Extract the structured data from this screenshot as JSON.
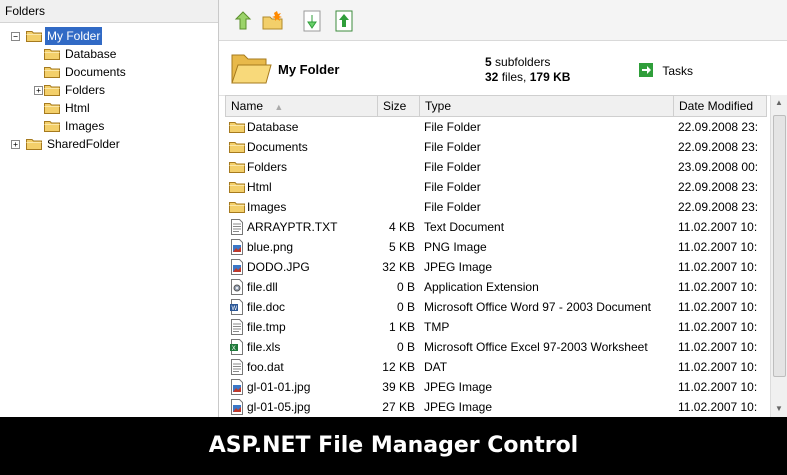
{
  "tree": {
    "header": "Folders",
    "nodes": [
      {
        "label": "My Folder",
        "selected": true,
        "expander": "−"
      },
      {
        "label": "Database"
      },
      {
        "label": "Documents"
      },
      {
        "label": "Folders",
        "expander": "+"
      },
      {
        "label": "Html"
      },
      {
        "label": "Images"
      },
      {
        "label": "SharedFolder",
        "expander": "+"
      }
    ]
  },
  "info": {
    "folder_name": "My Folder",
    "subfolders_count": "5",
    "subfolders_label": "subfolders",
    "files_count": "32",
    "files_label": "files,",
    "size": "179 KB",
    "tasks_label": "Tasks"
  },
  "grid": {
    "headers": {
      "name": "Name",
      "size": "Size",
      "type": "Type",
      "date": "Date Modified"
    },
    "rows": [
      {
        "name": "Database",
        "size": "",
        "type": "File Folder",
        "date": "22.09.2008 23:",
        "icon": "folder-icon"
      },
      {
        "name": "Documents",
        "size": "",
        "type": "File Folder",
        "date": "22.09.2008 23:",
        "icon": "folder-icon"
      },
      {
        "name": "Folders",
        "size": "",
        "type": "File Folder",
        "date": "23.09.2008 00:",
        "icon": "folder-icon"
      },
      {
        "name": "Html",
        "size": "",
        "type": "File Folder",
        "date": "22.09.2008 23:",
        "icon": "folder-icon"
      },
      {
        "name": "Images",
        "size": "",
        "type": "File Folder",
        "date": "22.09.2008 23:",
        "icon": "folder-icon"
      },
      {
        "name": "ARRAYPTR.TXT",
        "size": "4 KB",
        "type": "Text Document",
        "date": "11.02.2007 10:",
        "icon": "text-file-icon"
      },
      {
        "name": "blue.png",
        "size": "5 KB",
        "type": "PNG Image",
        "date": "11.02.2007 10:",
        "icon": "image-file-icon"
      },
      {
        "name": "DODO.JPG",
        "size": "32 KB",
        "type": "JPEG Image",
        "date": "11.02.2007 10:",
        "icon": "image-file-icon"
      },
      {
        "name": "file.dll",
        "size": "0 B",
        "type": "Application Extension",
        "date": "11.02.2007 10:",
        "icon": "dll-file-icon"
      },
      {
        "name": "file.doc",
        "size": "0 B",
        "type": "Microsoft Office Word 97 - 2003 Document",
        "date": "11.02.2007 10:",
        "icon": "word-file-icon"
      },
      {
        "name": "file.tmp",
        "size": "1 KB",
        "type": "TMP",
        "date": "11.02.2007 10:",
        "icon": "generic-file-icon"
      },
      {
        "name": "file.xls",
        "size": "0 B",
        "type": "Microsoft Office Excel 97-2003 Worksheet",
        "date": "11.02.2007 10:",
        "icon": "excel-file-icon"
      },
      {
        "name": "foo.dat",
        "size": "12 KB",
        "type": "DAT",
        "date": "11.02.2007 10:",
        "icon": "generic-file-icon"
      },
      {
        "name": "gl-01-01.jpg",
        "size": "39 KB",
        "type": "JPEG Image",
        "date": "11.02.2007 10:",
        "icon": "image-file-icon"
      },
      {
        "name": "gl-01-05.jpg",
        "size": "27 KB",
        "type": "JPEG Image",
        "date": "11.02.2007 10:",
        "icon": "image-file-icon"
      }
    ]
  },
  "banner": "ASP.NET File Manager Control",
  "colors": {
    "selection": "#316ac5",
    "folder": "#f3cf6a",
    "green_arrow": "#2f9e3a"
  }
}
